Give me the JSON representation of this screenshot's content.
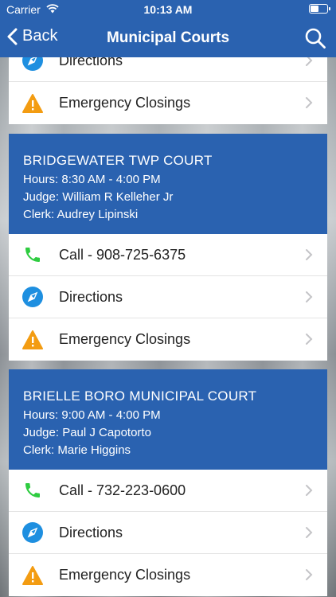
{
  "status_bar": {
    "carrier": "Carrier",
    "time": "10:13 AM"
  },
  "nav": {
    "back_label": "Back",
    "title": "Municipal Courts"
  },
  "partial_card": {
    "rows": [
      {
        "icon": "compass-icon",
        "label": "Directions"
      },
      {
        "icon": "warning-icon",
        "label": "Emergency Closings"
      }
    ]
  },
  "courts": [
    {
      "name": "BRIDGEWATER TWP COURT",
      "hours": "Hours: 8:30 AM - 4:00 PM",
      "judge": "Judge: William R Kelleher Jr",
      "clerk": "Clerk: Audrey Lipinski",
      "call_label": "Call - 908-725-6375",
      "directions_label": "Directions",
      "closings_label": "Emergency Closings"
    },
    {
      "name": "BRIELLE BORO MUNICIPAL COURT",
      "hours": "Hours: 9:00 AM - 4:00 PM",
      "judge": "Judge: Paul J Capotorto",
      "clerk": "Clerk: Marie Higgins",
      "call_label": "Call - 732-223-0600",
      "directions_label": "Directions",
      "closings_label": "Emergency Closings"
    }
  ],
  "colors": {
    "accent": "#2a62b0",
    "phone": "#2ecc40",
    "compass": "#1e8fe0",
    "warning": "#f39c12"
  }
}
